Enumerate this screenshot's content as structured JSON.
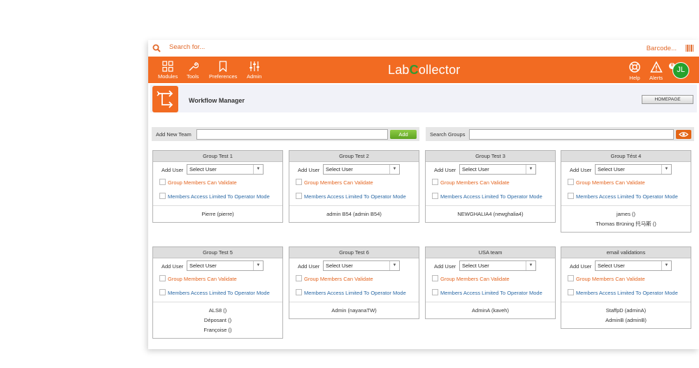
{
  "search": {
    "placeholder": "Search for...",
    "barcode_label": "Barcode..."
  },
  "nav": [
    {
      "label": "Modules",
      "icon": "grid-icon"
    },
    {
      "label": "Tools",
      "icon": "wrench-icon"
    },
    {
      "label": "Preferences",
      "icon": "bookmark-icon"
    },
    {
      "label": "Admin",
      "icon": "sliders-icon"
    }
  ],
  "logo": {
    "part1": "Lab",
    "part2": "C",
    "part3": "ollector"
  },
  "right_nav": {
    "help": "Help",
    "alerts": "Alerts",
    "alerts_count": "0",
    "avatar": "JL"
  },
  "module": {
    "title": "Workflow Manager",
    "homepage_button": "HOMEPAGE"
  },
  "toolbar": {
    "add_team_label": "Add New Team",
    "add_button": "Add",
    "search_groups_label": "Search Groups"
  },
  "card_common": {
    "add_user_label": "Add User",
    "select_placeholder": "Select User",
    "validate_label": "Group Members Can Validate",
    "operator_label": "Members Access Limited To Operator Mode"
  },
  "groups": [
    {
      "title": "Group Test 1",
      "members": [
        "Pierre (pierre)"
      ]
    },
    {
      "title": "Group Test 2",
      "members": [
        "admin B54 (admin B54)"
      ]
    },
    {
      "title": "Group Test 3",
      "members": [
        "NEWGHALIA4 (newghalia4)"
      ]
    },
    {
      "title": "Group Tést 4",
      "members": [
        "james ()",
        "Thomas Brüning 托马斯 ()"
      ]
    },
    {
      "title": "Group Test 5",
      "members": [
        "ALS8 ()",
        "Déposant ()",
        "Françoise ()"
      ]
    },
    {
      "title": "Group Test 6",
      "members": [
        "Admin (nayanaTW)"
      ]
    },
    {
      "title": "USA team",
      "members": [
        "AdminA (kaveh)"
      ]
    },
    {
      "title": "email validations",
      "members": [
        "StaffpD (adminA)",
        "AdminB (adminB)"
      ]
    }
  ],
  "colors": {
    "accent": "#f26b22",
    "logo_green": "#2f9a33",
    "link_blue": "#2b69a5",
    "add_green": "#6fb52c"
  }
}
